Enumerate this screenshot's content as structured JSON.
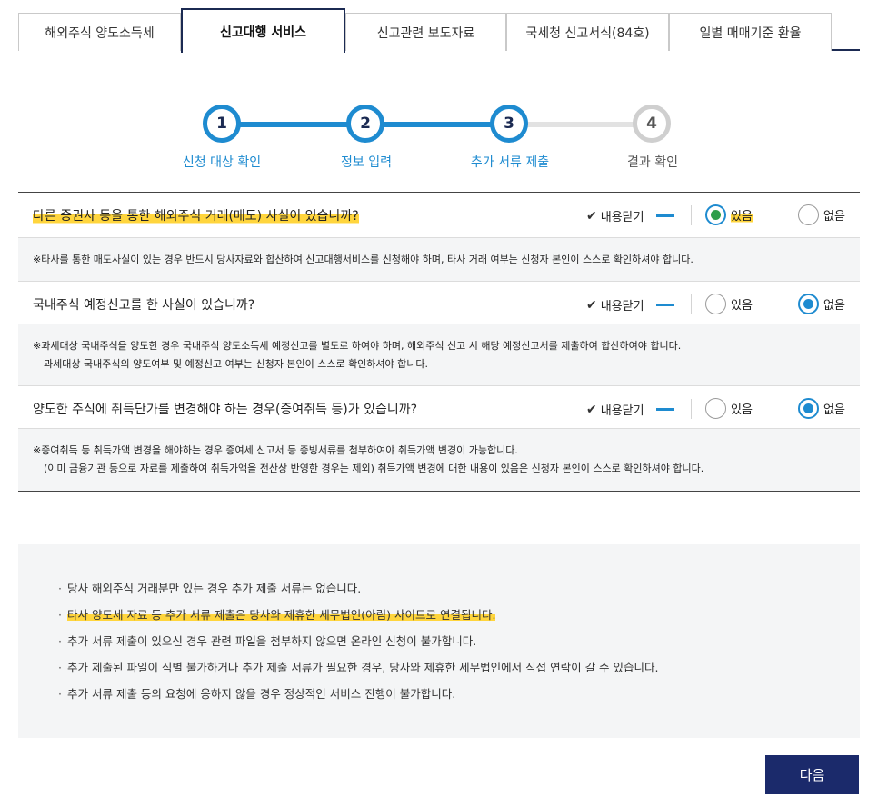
{
  "tabs": [
    {
      "label": "해외주식 양도소득세",
      "active": false
    },
    {
      "label": "신고대행 서비스",
      "active": true
    },
    {
      "label": "신고관련 보도자료",
      "active": false
    },
    {
      "label": "국세청 신고서식(84호)",
      "active": false
    },
    {
      "label": "일별 매매기준 환율",
      "active": false
    }
  ],
  "steps": [
    {
      "number": "1",
      "label": "신청 대상 확인",
      "state": "done"
    },
    {
      "number": "2",
      "label": "정보 입력",
      "state": "done"
    },
    {
      "number": "3",
      "label": "추가 서류 제출",
      "state": "current"
    },
    {
      "number": "4",
      "label": "결과 확인",
      "state": "todo"
    }
  ],
  "questions": [
    {
      "text": "다른 증권사 등을 통한 해외주식 거래(매도) 사실이 있습니까?",
      "toggle_label": "내용닫기",
      "yes_label": "있음",
      "no_label": "없음",
      "selected": "yes",
      "notes": [
        "※타사를 통한 매도사실이 있는 경우 반드시 당사자료와 합산하여 신고대행서비스를 신청해야 하며, 타사 거래 여부는 신청자 본인이 스스로 확인하셔야 합니다."
      ]
    },
    {
      "text": "국내주식 예정신고를 한 사실이 있습니까?",
      "toggle_label": "내용닫기",
      "yes_label": "있음",
      "no_label": "없음",
      "selected": "no",
      "notes": [
        "※과세대상 국내주식을 양도한 경우 국내주식 양도소득세 예정신고를 별도로 하여야 하며, 해외주식 신고 시 해당 예정신고서를 제출하여 합산하여야 합니다.",
        "과세대상 국내주식의 양도여부 및 예정신고 여부는 신청자 본인이 스스로 확인하셔야 합니다."
      ]
    },
    {
      "text": "양도한 주식에 취득단가를 변경해야 하는 경우(증여취득 등)가 있습니까?",
      "toggle_label": "내용닫기",
      "yes_label": "있음",
      "no_label": "없음",
      "selected": "no",
      "notes": [
        "※증여취득 등 취득가액 변경을 해야하는 경우 증여세 신고서 등 증빙서류를 첨부하여야 취득가액 변경이 가능합니다.",
        "(이미 금융기관 등으로 자료를 제출하여 취득가액을 전산상 반영한 경우는 제외) 취득가액 변경에 대한 내용이 있음은 신청자 본인이 스스로 확인하셔야 합니다."
      ]
    }
  ],
  "info": [
    "당사 해외주식 거래분만 있는 경우 추가 제출 서류는 없습니다.",
    "타사 양도세 자료 등 추가 서류 제출은 당사와 제휴한 세무법인(아림) 사이트로 연결됩니다.",
    "추가 서류 제출이 있으신 경우 관련 파일을 첨부하지 않으면 온라인 신청이 불가합니다.",
    "추가 제출된 파일이 식별 불가하거나 추가 제출 서류가 필요한 경우, 당사와 제휴한 세무법인에서 직접 연락이 갈 수 있습니다.",
    "추가 서류 제출 등의 요청에 응하지 않을 경우 정상적인 서비스 진행이 불가합니다."
  ],
  "next_button": "다음",
  "colors": {
    "navy": "#1b2a52",
    "blue": "#1e8bd0",
    "highlight": "#ffd53d",
    "button": "#1b2a6b"
  }
}
